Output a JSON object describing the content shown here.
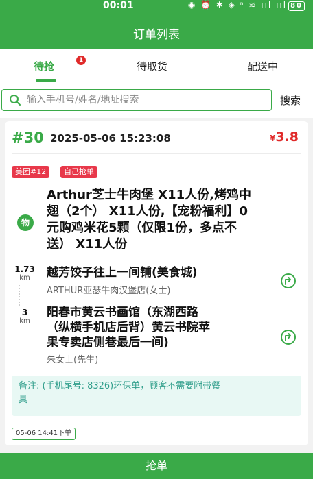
{
  "status_bar": {
    "time": "00:01",
    "icons": "◉ ⏰ ✱ ◈ ⁿ ≋ ııl ııl",
    "battery": "80"
  },
  "header": {
    "title": "订单列表"
  },
  "tabs": [
    {
      "label": "待抢",
      "active": true,
      "badge": "1"
    },
    {
      "label": "待取货",
      "active": false
    },
    {
      "label": "配送中",
      "active": false
    }
  ],
  "search": {
    "placeholder": "输入手机号/姓名/地址搜索",
    "value": "",
    "button_label": "搜索"
  },
  "order": {
    "number": "#30",
    "time": "2025-05-06 15:23:08",
    "price_currency": "¥",
    "price_value": "3.8",
    "tags": [
      "美团#12",
      "自己抢单"
    ],
    "goods_icon_label": "物",
    "goods_lines": [
      "Arthur芝士牛肉堡 X11人份,烤鸡中",
      "翅（2个） X11人份,【宠粉福利】0",
      "元购鸡米花5颗（仅限1份，多点不",
      "送） X11人份"
    ],
    "shop": {
      "distance_num": "1.73",
      "distance_unit": "km",
      "name": "越芳饺子往上一间铺(美食城)",
      "sub": "ARTHUR亚瑟牛肉汉堡店(女士)"
    },
    "address": {
      "distance_num": "3",
      "distance_unit": "km",
      "lines": [
        "阳春市黄云书画馆（东湖西路",
        "（纵横手机店后背）黄云书院苹",
        "果专卖店侧巷最后一间)"
      ],
      "customer": "朱女士(先生)"
    },
    "remark_lines": [
      "备注: (手机尾号: 8326)环保单，顾客不需要附带餐",
      "具"
    ],
    "deadline": "05-06 14:41下单"
  },
  "grab_button_label": "抢单",
  "colors": {
    "primary": "#3aaa48",
    "price": "#e02a2a",
    "tag": "#e8384a",
    "remark_bg": "#e8f8f4",
    "remark_text": "#2e9d8a"
  }
}
